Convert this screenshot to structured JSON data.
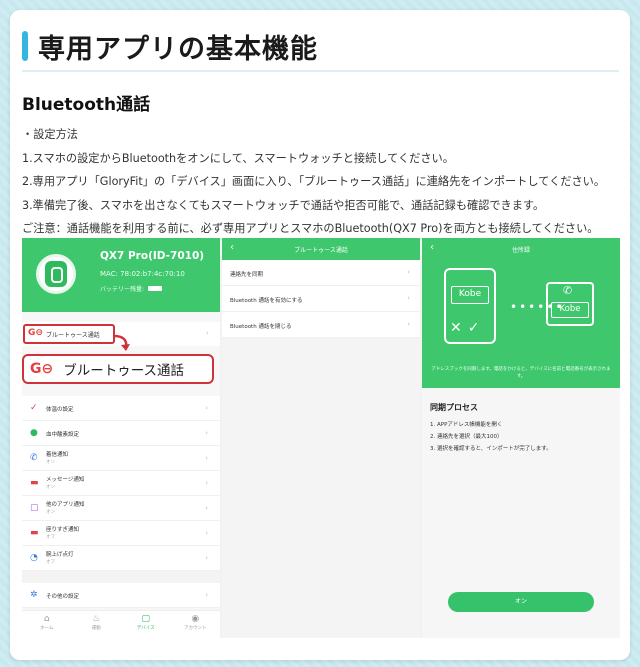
{
  "title": "専用アプリの基本機能",
  "section_heading": "Bluetooth通話",
  "instructions": [
    "・設定方法",
    "1.スマホの設定からBluetoothをオンにして、スマートウォッチと接続してください。",
    "2.専用アプリ「GloryFit」の「デバイス」画面に入り、「ブルートゥース通話」に連絡先をインポートしてください。",
    "3.準備完了後、スマホを出さなくてもスマートウォッチで通話や拒否可能で、通話記録も確認できます。",
    "ご注意：通話機能を利用する前に、必ず専用アプリとスマホのBluetooth(QX7 Pro)を両方とも接続してください。"
  ],
  "phone1": {
    "device_name": "QX7 Pro(ID-7010)",
    "mac": "MAC: 78:02:b7:4c:70:10",
    "battery_label": "バッテリー残量:",
    "bt_call_small": "ブルートゥース通話",
    "bt_call_big": "ブルートゥース通話",
    "items": [
      {
        "label": "体温の設定",
        "sub": "",
        "icon": "✓",
        "color": "#e0444a"
      },
      {
        "label": "血中酸素設定",
        "sub": "",
        "icon": "●",
        "color": "#2fb95d"
      },
      {
        "label": "着信通知",
        "sub": "オン",
        "icon": "✆",
        "color": "#2f7de0"
      },
      {
        "label": "メッセージ通知",
        "sub": "オン",
        "icon": "▬",
        "color": "#e0444a"
      },
      {
        "label": "他のアプリ通知",
        "sub": "オン",
        "icon": "▢",
        "color": "#a55ae0"
      },
      {
        "label": "座りすぎ通知",
        "sub": "オフ",
        "icon": "▬",
        "color": "#e0444a"
      },
      {
        "label": "腕上げ点灯",
        "sub": "オフ",
        "icon": "◔",
        "color": "#2f7de0"
      }
    ],
    "other_settings": "その他の設定",
    "tabs": [
      {
        "label": "ホーム",
        "icon": "⌂",
        "active": false
      },
      {
        "label": "運動",
        "icon": "♨",
        "active": false
      },
      {
        "label": "デバイス",
        "icon": "▢",
        "active": true
      },
      {
        "label": "アカウント",
        "icon": "◉",
        "active": false
      }
    ]
  },
  "phone2": {
    "title": "ブルートゥース通話",
    "items": [
      "連絡先を同期",
      "Bluetooth 通話を有効にする",
      "Bluetooth 通話を閉じる"
    ]
  },
  "phone3": {
    "title": "住所録",
    "contact_left": "Kobe",
    "contact_right": "Kobe",
    "note": "アドレスブックを同期します。電話をかけると、デバイスに名前と電話番号が表示されます。",
    "sync_title": "同期プロセス",
    "steps": [
      "1. APPアドレス帳機能を開く",
      "2. 連絡先を選択（最大100）",
      "3. 選択を確認すると、インポートが完了します。"
    ],
    "button": "オン"
  },
  "colors": {
    "accent": "#35b6e0",
    "app_green": "#3ec76c",
    "highlight": "#d0323a"
  }
}
